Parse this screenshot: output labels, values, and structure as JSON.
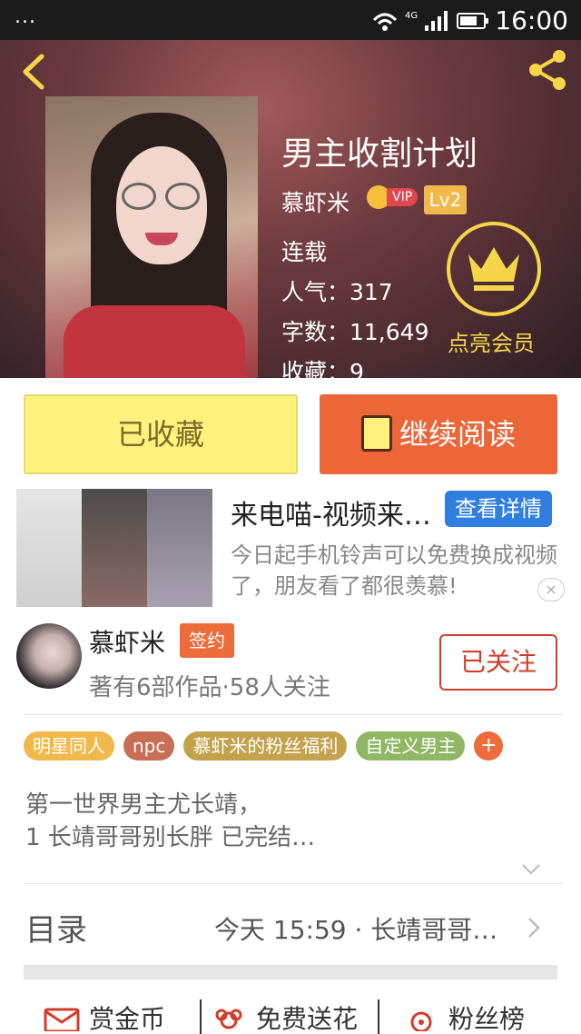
{
  "status_bar": {
    "left": "...",
    "network": "4G",
    "time": "16:00"
  },
  "book": {
    "title": "男主收割计划",
    "author": "慕虾米",
    "vip_label": "VIP",
    "level": "Lv2",
    "status": "连载",
    "popularity": "人气：317",
    "words": "字数：11,649",
    "favorites": "收藏：9",
    "member_label": "点亮会员"
  },
  "buttons": {
    "favorited": "已收藏",
    "continue_reading": "继续阅读"
  },
  "ad": {
    "title": "来电喵-视频来…",
    "button": "查看详情",
    "description": "今日起手机铃声可以免费换成视频了，朋友看了都很羡慕!",
    "close": "×"
  },
  "author_row": {
    "name": "慕虾米",
    "signed_badge": "签约",
    "works_info": "著有6部作品·58人关注",
    "follow_button": "已关注"
  },
  "tags": [
    {
      "label": "明星同人",
      "color": "#f1b94b"
    },
    {
      "label": "npc",
      "color": "#c86d56"
    },
    {
      "label": "慕虾米的粉丝福利",
      "color": "#c4a24c"
    },
    {
      "label": "自定义男主",
      "color": "#8fb764"
    }
  ],
  "tag_add": "+",
  "summary": {
    "line1": "第一世界男主尤长靖，",
    "line2": "1 长靖哥哥别长胖  已完结…"
  },
  "toc": {
    "label": "目录",
    "update": "今天 15:59 · 长靖哥哥…"
  },
  "actions": {
    "reward": "赏金币",
    "flower": "免费送花",
    "fans": "粉丝榜"
  },
  "colors": {
    "accent_orange": "#ec6637",
    "yellow": "#fef17c",
    "crown": "#f6d648",
    "follow_red": "#d23d2a"
  }
}
